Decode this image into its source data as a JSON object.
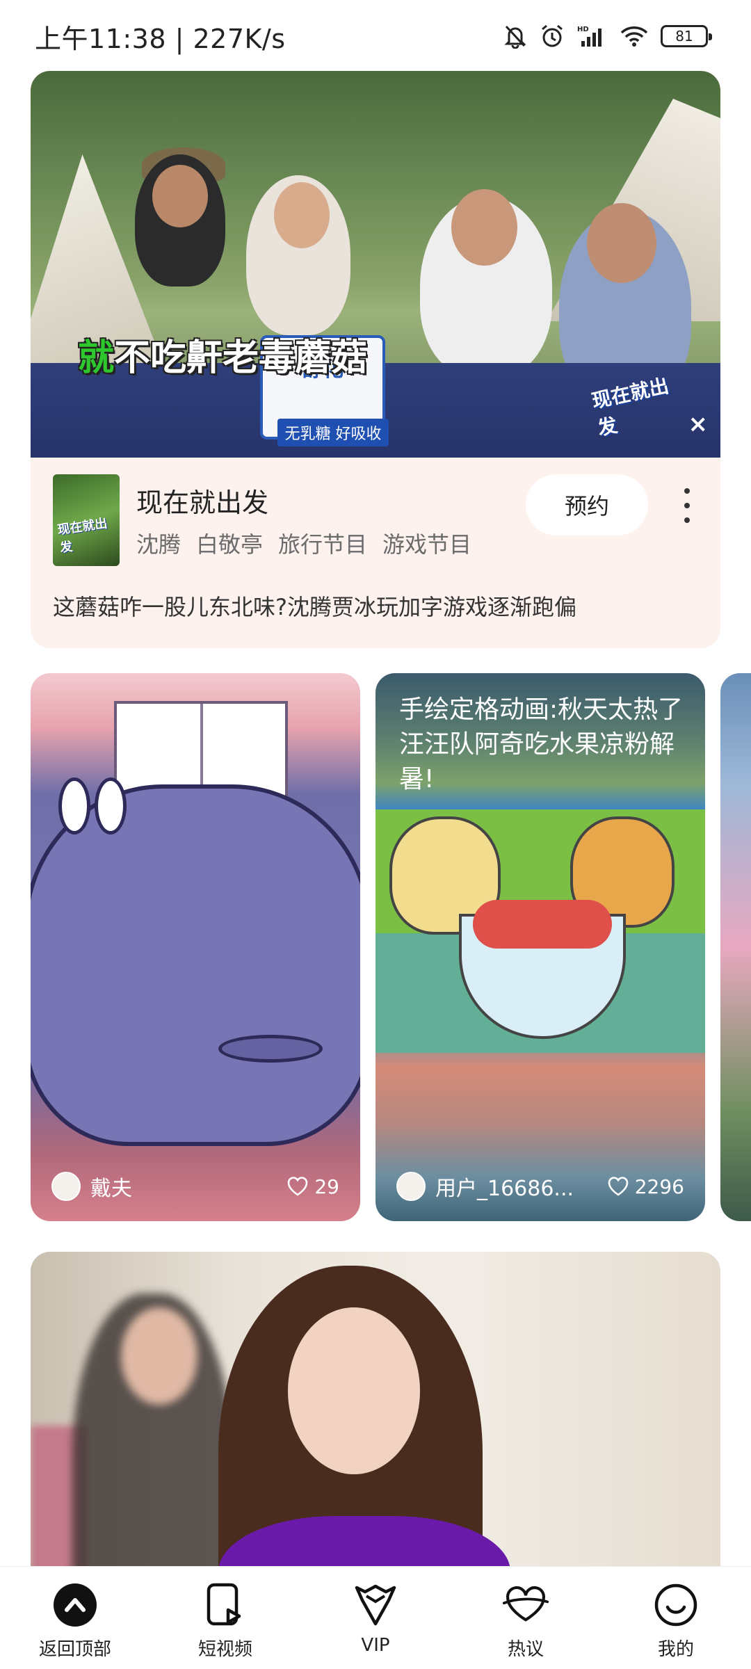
{
  "status_bar": {
    "time": "上午11:38 | 227K/s",
    "battery": "81"
  },
  "featured": {
    "subtitle_first": "就",
    "subtitle_rest": "不吃鼾老毒蘑菇",
    "logo_text": "现在就出发",
    "title": "现在就出发",
    "tags": [
      "沈腾",
      "白敬亭",
      "旅行节目",
      "游戏节目"
    ],
    "reserve_label": "预约",
    "description": "这蘑菇咋一股儿东北味?沈腾贾冰玩加字游戏逐渐跑偏",
    "milk_brand": "舒化",
    "milk_label": "无乳糖 好吸收"
  },
  "cards": [
    {
      "title": "",
      "author": "戴夫",
      "likes": "29"
    },
    {
      "title": "手绘定格动画:秋天太热了汪汪队阿奇吃水果凉粉解暑!",
      "author": "用户_16686...",
      "likes": "2296"
    }
  ],
  "nav": {
    "items": [
      {
        "label": "返回顶部",
        "icon": "back-to-top-icon"
      },
      {
        "label": "短视频",
        "icon": "short-video-icon"
      },
      {
        "label": "VIP",
        "icon": "vip-crown-icon"
      },
      {
        "label": "热议",
        "icon": "discussion-icon"
      },
      {
        "label": "我的",
        "icon": "profile-smile-icon"
      }
    ]
  }
}
